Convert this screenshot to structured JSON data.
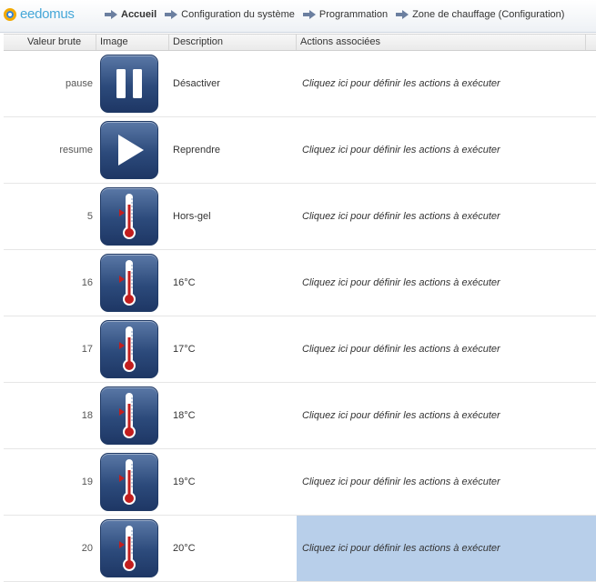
{
  "app": {
    "logo_text": "eedomus"
  },
  "breadcrumb": [
    {
      "label": "Accueil",
      "bold": true
    },
    {
      "label": "Configuration du système",
      "bold": false
    },
    {
      "label": "Programmation",
      "bold": false
    },
    {
      "label": "Zone de chauffage (Configuration)",
      "bold": false
    }
  ],
  "table": {
    "headers": [
      "Valeur brute",
      "Image",
      "Description",
      "Actions associées"
    ],
    "rows": [
      {
        "raw": "pause",
        "icon": "pause-icon",
        "description": "Désactiver",
        "action": "Cliquez ici pour définir les actions à exécuter"
      },
      {
        "raw": "resume",
        "icon": "play-icon",
        "description": "Reprendre",
        "action": "Cliquez ici pour définir les actions à exécuter"
      },
      {
        "raw": "5",
        "icon": "thermometer-icon",
        "description": "Hors-gel",
        "action": "Cliquez ici pour définir les actions à exécuter"
      },
      {
        "raw": "16",
        "icon": "thermometer-icon",
        "description": "16°C",
        "action": "Cliquez ici pour définir les actions à exécuter"
      },
      {
        "raw": "17",
        "icon": "thermometer-icon",
        "description": "17°C",
        "action": "Cliquez ici pour définir les actions à exécuter"
      },
      {
        "raw": "18",
        "icon": "thermometer-icon",
        "description": "18°C",
        "action": "Cliquez ici pour définir les actions à exécuter"
      },
      {
        "raw": "19",
        "icon": "thermometer-icon",
        "description": "19°C",
        "action": "Cliquez ici pour définir les actions à exécuter"
      },
      {
        "raw": "20",
        "icon": "thermometer-icon",
        "description": "20°C",
        "action": "Cliquez ici pour définir les actions à exécuter",
        "selected": true
      }
    ]
  },
  "colors": {
    "selected_row": "#b8cfea",
    "tile": "#2c4a7b",
    "logo_ring": "#f2a900",
    "logo_text": "#46a7d8"
  }
}
